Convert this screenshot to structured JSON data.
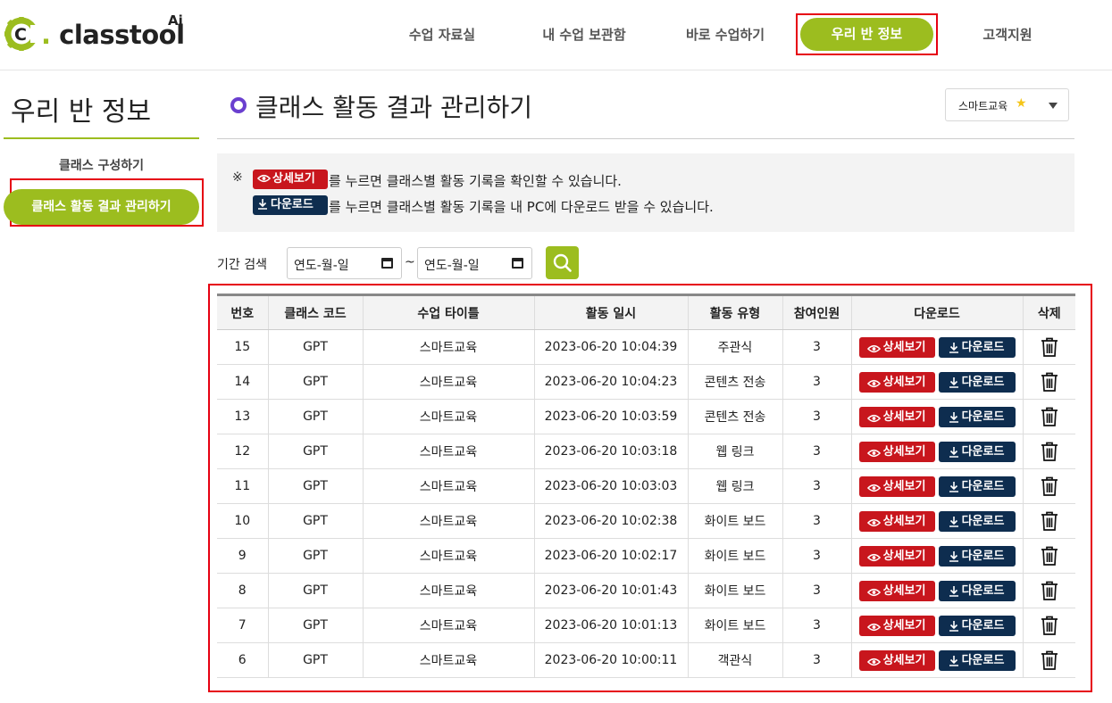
{
  "header": {
    "logo_text": "classtool",
    "logo_dot": ".",
    "logo_c": "C",
    "logo_ai": "Ai",
    "nav": [
      "수업 자료실",
      "내 수업 보관함",
      "바로 수업하기",
      "우리 반 정보",
      "고객지원"
    ],
    "nav_active_index": 3,
    "accent_color": "#9cbd1f",
    "highlight_color": "#e60012"
  },
  "sidebar": {
    "title": "우리 반 정보",
    "items": [
      "클래스 구성하기",
      "클래스 활동 결과 관리하기"
    ],
    "active_index": 1
  },
  "main": {
    "title": "클래스 활동 결과 관리하기",
    "dropdown": {
      "selected": "스마트교육",
      "icon": "star-icon"
    }
  },
  "info": {
    "mark": "※",
    "detail_chip": "상세보기",
    "download_chip": "다운로드",
    "line1": "를 누르면 클래스별 활동 기록을 확인할 수 있습니다.",
    "line2": "를 누르면 클래스별 활동 기록을 내 PC에 다운로드 받을 수 있습니다."
  },
  "search": {
    "label": "기간 검색",
    "from_placeholder": "연도-월-일",
    "to_placeholder": "연도-월-일",
    "separator": "~"
  },
  "table": {
    "headers": [
      "번호",
      "클래스 코드",
      "수업 타이틀",
      "활동 일시",
      "활동 유형",
      "참여인원",
      "다운로드",
      "삭제"
    ],
    "detail_label": "상세보기",
    "download_label": "다운로드",
    "rows": [
      {
        "no": "15",
        "code": "GPT",
        "title": "스마트교육",
        "datetime": "2023-06-20 10:04:39",
        "type": "주관식",
        "count": "3"
      },
      {
        "no": "14",
        "code": "GPT",
        "title": "스마트교육",
        "datetime": "2023-06-20 10:04:23",
        "type": "콘텐츠 전송",
        "count": "3"
      },
      {
        "no": "13",
        "code": "GPT",
        "title": "스마트교육",
        "datetime": "2023-06-20 10:03:59",
        "type": "콘텐츠 전송",
        "count": "3"
      },
      {
        "no": "12",
        "code": "GPT",
        "title": "스마트교육",
        "datetime": "2023-06-20 10:03:18",
        "type": "웹 링크",
        "count": "3"
      },
      {
        "no": "11",
        "code": "GPT",
        "title": "스마트교육",
        "datetime": "2023-06-20 10:03:03",
        "type": "웹 링크",
        "count": "3"
      },
      {
        "no": "10",
        "code": "GPT",
        "title": "스마트교육",
        "datetime": "2023-06-20 10:02:38",
        "type": "화이트 보드",
        "count": "3"
      },
      {
        "no": "9",
        "code": "GPT",
        "title": "스마트교육",
        "datetime": "2023-06-20 10:02:17",
        "type": "화이트 보드",
        "count": "3"
      },
      {
        "no": "8",
        "code": "GPT",
        "title": "스마트교육",
        "datetime": "2023-06-20 10:01:43",
        "type": "화이트 보드",
        "count": "3"
      },
      {
        "no": "7",
        "code": "GPT",
        "title": "스마트교육",
        "datetime": "2023-06-20 10:01:13",
        "type": "화이트 보드",
        "count": "3"
      },
      {
        "no": "6",
        "code": "GPT",
        "title": "스마트교육",
        "datetime": "2023-06-20 10:00:11",
        "type": "객관식",
        "count": "3"
      }
    ]
  }
}
